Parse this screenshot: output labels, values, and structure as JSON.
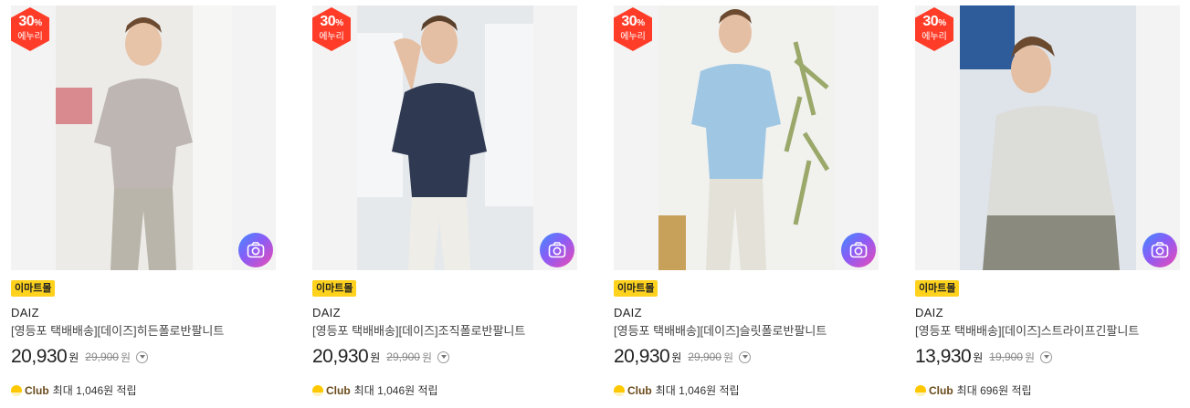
{
  "products": [
    {
      "discount_pct": "30",
      "discount_unit": "%",
      "discount_label": "에누리",
      "mall": "이마트몰",
      "brand": "DAIZ",
      "title": "[영등포 택배배송][데이즈]히든폴로반팔니트",
      "price": "20,930",
      "price_unit": "원",
      "original_price": "29,900",
      "original_unit": "원",
      "club_name": "Club",
      "club_text": "최대 1,046원 적립",
      "shirt_color": "#bdb6b2",
      "pants_color": "#b9b5aa",
      "bg_color": "#ecebe8"
    },
    {
      "discount_pct": "30",
      "discount_unit": "%",
      "discount_label": "에누리",
      "mall": "이마트몰",
      "brand": "DAIZ",
      "title": "[영등포 택배배송][데이즈]조직폴로반팔니트",
      "price": "20,930",
      "price_unit": "원",
      "original_price": "29,900",
      "original_unit": "원",
      "club_name": "Club",
      "club_text": "최대 1,046원 적립",
      "shirt_color": "#2f3a52",
      "pants_color": "#eeede8",
      "bg_color": "#e6e9ec"
    },
    {
      "discount_pct": "30",
      "discount_unit": "%",
      "discount_label": "에누리",
      "mall": "이마트몰",
      "brand": "DAIZ",
      "title": "[영등포 택배배송][데이즈]슬릿폴로반팔니트",
      "price": "20,930",
      "price_unit": "원",
      "original_price": "29,900",
      "original_unit": "원",
      "club_name": "Club",
      "club_text": "최대 1,046원 적립",
      "shirt_color": "#9fc7e4",
      "pants_color": "#e4e1d8",
      "bg_color": "#f1f1ee"
    },
    {
      "discount_pct": "30",
      "discount_unit": "%",
      "discount_label": "에누리",
      "mall": "이마트몰",
      "brand": "DAIZ",
      "title": "[영등포 택배배송][데이즈]스트라이프긴팔니트",
      "price": "13,930",
      "price_unit": "원",
      "original_price": "19,900",
      "original_unit": "원",
      "club_name": "Club",
      "club_text": "최대 696원 적립",
      "shirt_color": "#dcdcd8",
      "pants_color": "#8a8a7e",
      "bg_color": "#dfe4ea"
    }
  ],
  "icons": {
    "camera": "camera-icon",
    "info": "chevron-down-circle-icon",
    "club": "club-coin-icon"
  },
  "colors": {
    "discount_badge": "#ff3c28",
    "mall_badge": "#ffd21e",
    "club_coin": "#ffc800"
  }
}
